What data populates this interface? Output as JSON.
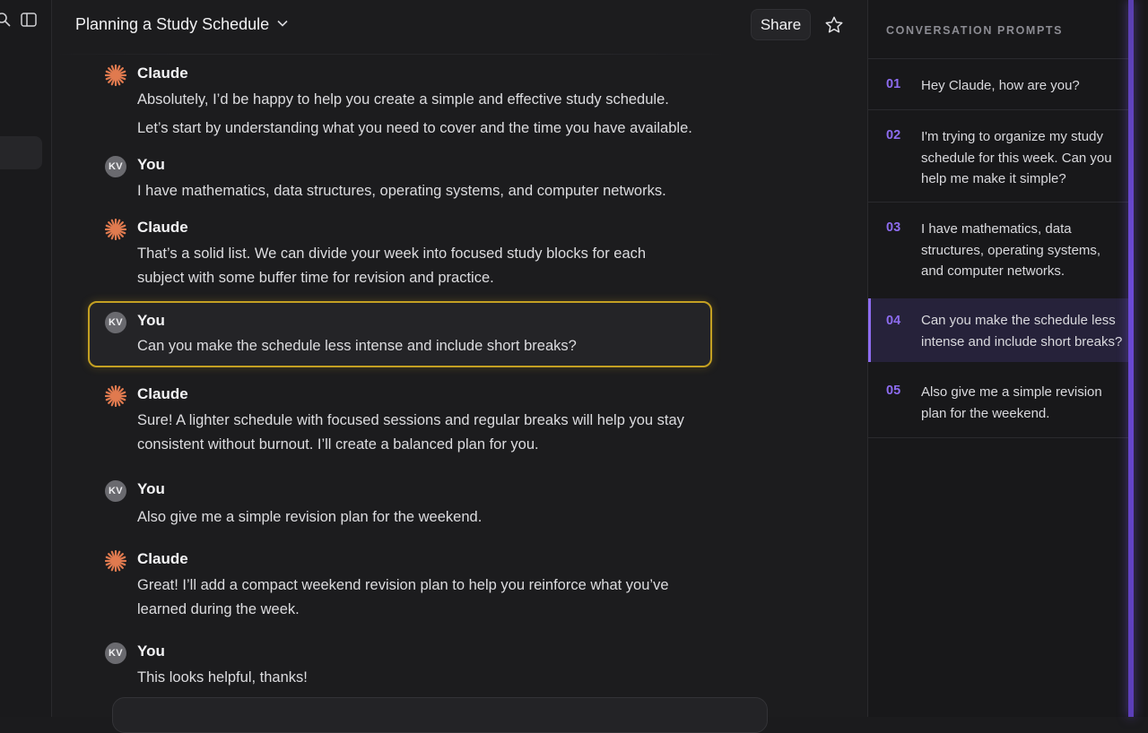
{
  "header": {
    "title": "Planning a Study Schedule",
    "share_label": "Share"
  },
  "messages": [
    {
      "role": "claude",
      "author": "Claude",
      "paragraphs": [
        "Absolutely, I’d be happy to help you create a simple and effective study schedule.",
        "Let’s start by understanding what you need to cover and the time you have available."
      ]
    },
    {
      "role": "user",
      "author": "You",
      "avatar": "KV",
      "paragraphs": [
        "I have mathematics, data structures, operating systems, and computer networks."
      ]
    },
    {
      "role": "claude",
      "author": "Claude",
      "paragraphs": [
        "That’s a solid list. We can divide your week into focused study blocks for each subject with some buffer time for revision and practice."
      ]
    },
    {
      "role": "user",
      "author": "You",
      "avatar": "KV",
      "highlighted": true,
      "paragraphs": [
        "Can you make the schedule less intense and include short breaks?"
      ]
    },
    {
      "role": "claude",
      "author": "Claude",
      "paragraphs": [
        "Sure! A lighter schedule with focused sessions and regular breaks will help you stay consistent without burnout. I’ll create a balanced plan for you."
      ]
    },
    {
      "role": "user",
      "author": "You",
      "avatar": "KV",
      "paragraphs": [
        "Also give me a simple revision plan for the weekend."
      ]
    },
    {
      "role": "claude",
      "author": "Claude",
      "paragraphs": [
        "Great! I’ll add a compact weekend revision plan to help you reinforce what you’ve learned during the week."
      ]
    },
    {
      "role": "user",
      "author": "You",
      "avatar": "KV",
      "paragraphs": [
        "This looks helpful, thanks!"
      ]
    }
  ],
  "prompts_panel": {
    "heading": "CONVERSATION PROMPTS",
    "items": [
      {
        "num": "01",
        "text": "Hey Claude, how are you?"
      },
      {
        "num": "02",
        "text": "I'm trying to organize my study schedule for this week. Can you help me make it simple?"
      },
      {
        "num": "03",
        "text": "I have mathematics, data structures, operating systems, and computer networks."
      },
      {
        "num": "04",
        "text": "Can you make the schedule less intense and include short breaks?",
        "active": true
      },
      {
        "num": "05",
        "text": "Also give me a simple revision plan for the weekend."
      }
    ]
  },
  "icons": {
    "search": "search-icon",
    "sidebar_toggle": "sidebar-toggle-icon",
    "chevron": "chevron-down-icon",
    "star": "star-icon",
    "claude_logo": "claude-logo-icon"
  },
  "colors": {
    "accent_purple": "#8d6cf0",
    "claude_orange": "#e07a4f",
    "highlight_gold": "#c4a022"
  }
}
